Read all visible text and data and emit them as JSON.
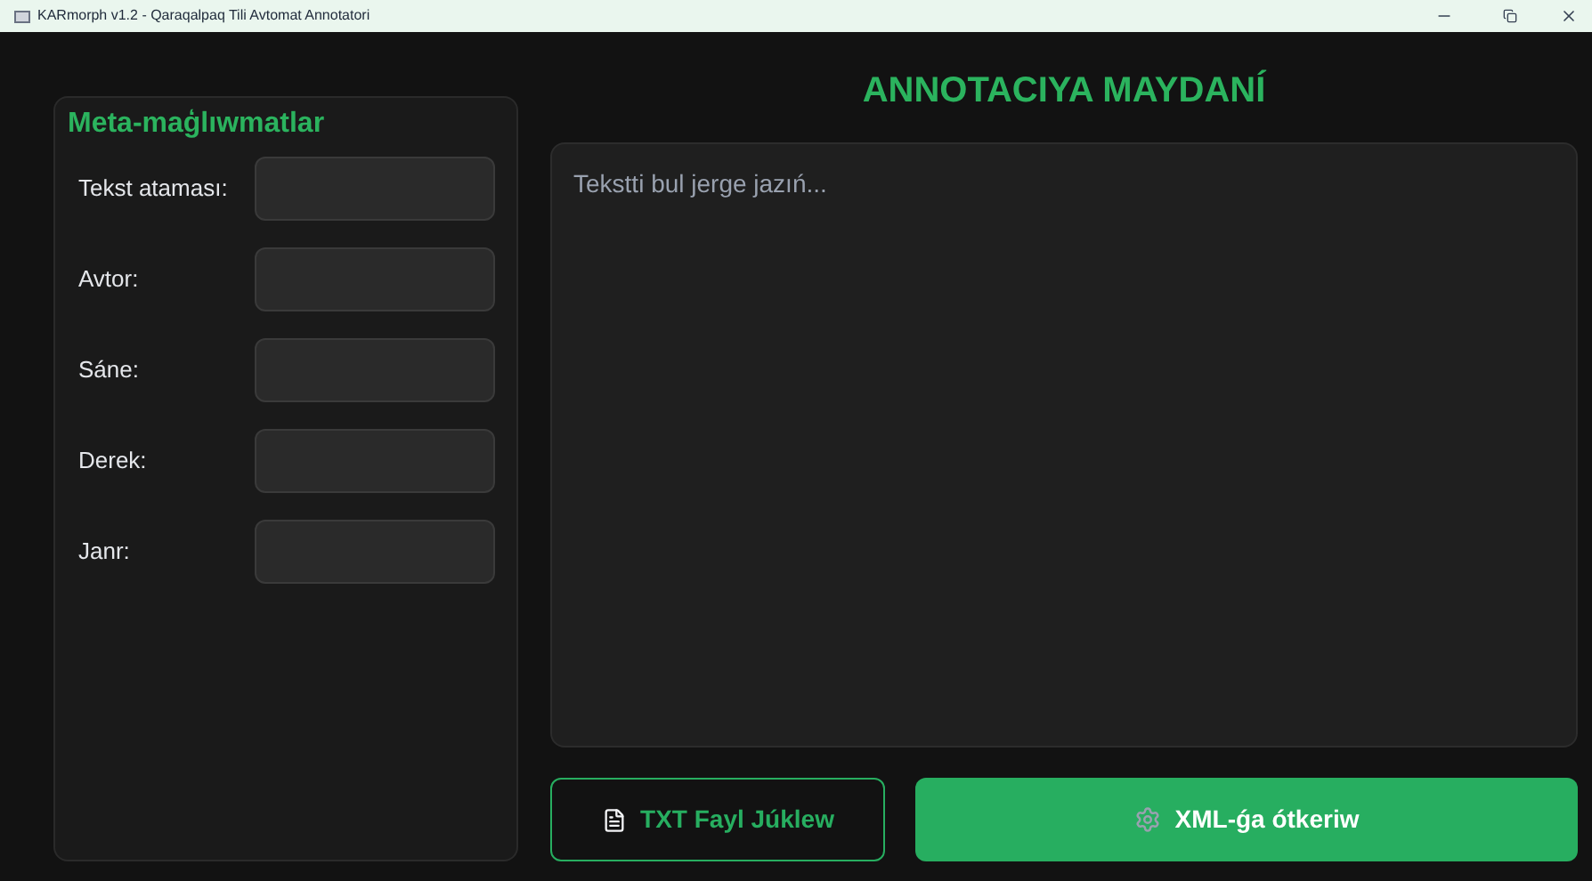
{
  "window": {
    "title": "KARmorph v1.2 - Qaraqalpaq Tili Avtomat Annotatori"
  },
  "meta_panel": {
    "title": "Meta-maģlıwmatlar",
    "fields": [
      {
        "label": "Tekst ataması:"
      },
      {
        "label": "Avtor:"
      },
      {
        "label": "Sáne:"
      },
      {
        "label": "Derek:"
      },
      {
        "label": "Janr:"
      }
    ]
  },
  "annotation": {
    "title": "ANNOTACIYA MAYDANÍ",
    "placeholder": "Tekstti bul jerge jazıń..."
  },
  "buttons": [
    {
      "label": "TXT Fayl Júklew",
      "kind": "outline"
    },
    {
      "label": "XML-ǵa ótkeriw",
      "kind": "filled"
    }
  ]
}
